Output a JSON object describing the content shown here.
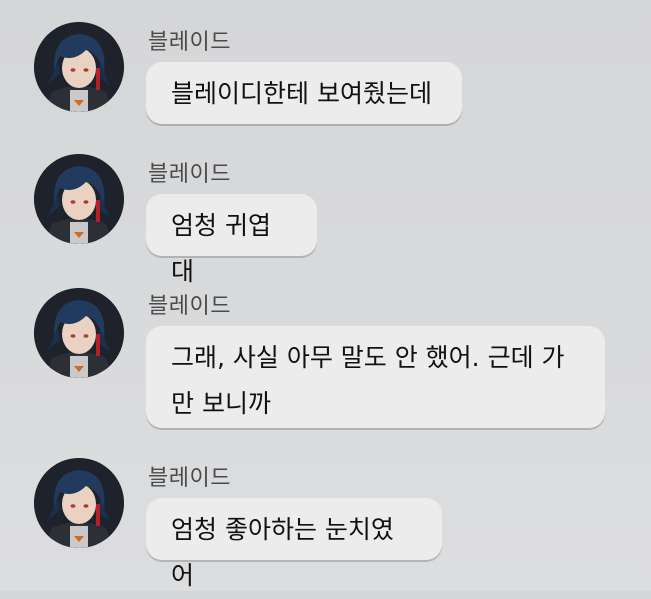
{
  "chat": {
    "messages": [
      {
        "sender": "블레이드",
        "text": "블레이디한테 보여줬는데",
        "avatar_icon": "character-avatar-icon"
      },
      {
        "sender": "블레이드",
        "text": "엄청 귀엽대",
        "avatar_icon": "character-avatar-icon"
      },
      {
        "sender": "블레이드",
        "text": "그래, 사실 아무 말도 안 했어. 근데 가만 보니까",
        "avatar_icon": "character-avatar-icon"
      },
      {
        "sender": "블레이드",
        "text": "엄청 좋아하는 눈치였어",
        "avatar_icon": "character-avatar-icon"
      }
    ]
  },
  "colors": {
    "background": "#d8d9db",
    "bubble": "#ececec",
    "sender_text": "#4a4a4a",
    "message_text": "#111111"
  }
}
